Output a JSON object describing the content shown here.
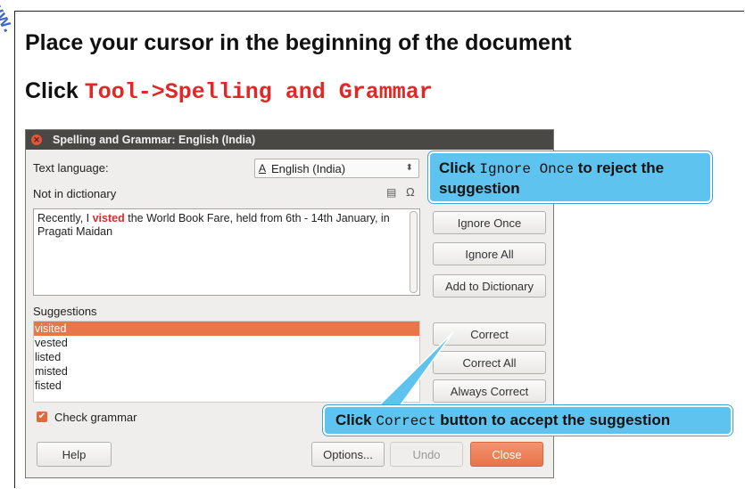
{
  "watermark": "ww.",
  "heading1": "Place your cursor in the beginning of the document",
  "heading2": {
    "prefix": "Click ",
    "code": "Tool->Spelling and Grammar"
  },
  "dialog": {
    "title": "Spelling and Grammar: English (India)",
    "text_language_label": "Text language:",
    "language_value": "English (India)",
    "not_in_dictionary_label": "Not in dictionary",
    "sentence": {
      "before": "Recently, I ",
      "misspelled": "visted",
      "after": " the World Book Fare, held from 6th - 14th January, in Pragati Maidan"
    },
    "suggestions_label": "Suggestions",
    "suggestions": [
      "visited",
      "vested",
      "listed",
      "misted",
      "fisted"
    ],
    "buttons": {
      "ignore_once": "Ignore Once",
      "ignore_all": "Ignore All",
      "add_to_dictionary": "Add to Dictionary",
      "correct": "Correct",
      "correct_all": "Correct All",
      "always_correct": "Always Correct",
      "help": "Help",
      "options": "Options...",
      "undo": "Undo",
      "close": "Close"
    },
    "check_grammar_label": "Check grammar"
  },
  "callouts": {
    "ignore": {
      "pre": "Click ",
      "code": "Ignore Once",
      "post": " to reject the suggestion"
    },
    "correct": {
      "pre": "Click ",
      "code": "Correct",
      "post": " button to accept the suggestion"
    }
  },
  "colors": {
    "accent": "#e9754b",
    "callout": "#5ec3ef",
    "title_code": "#e32626"
  }
}
